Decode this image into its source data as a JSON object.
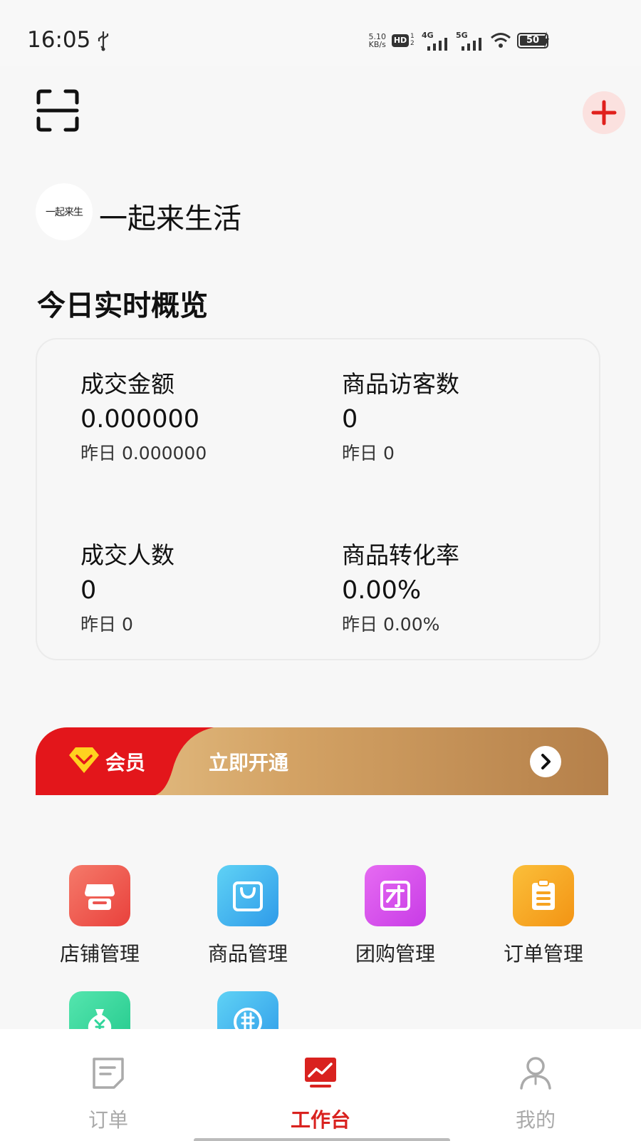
{
  "status_bar": {
    "time": "16:05",
    "net_speed_value": "5.10",
    "net_speed_unit": "KB/s",
    "hd_label": "HD",
    "signal_1": "4G",
    "signal_2": "5G",
    "battery": "50",
    "icons": [
      "usb-icon",
      "hd-icon",
      "signal-icon",
      "wifi-icon",
      "battery-icon",
      "charging-icon"
    ]
  },
  "header": {
    "icons": [
      "scan-icon",
      "add-icon"
    ],
    "accent_color": "#e0201c"
  },
  "shop": {
    "avatar_text": "一起来生",
    "name": "一起来生活"
  },
  "overview": {
    "title": "今日实时概览",
    "stats": [
      {
        "label": "成交金额",
        "value": "0.000000",
        "yesterday": "昨日 0.000000"
      },
      {
        "label": "商品访客数",
        "value": "0",
        "yesterday": "昨日 0"
      },
      {
        "label": "成交人数",
        "value": "0",
        "yesterday": "昨日 0"
      },
      {
        "label": "商品转化率",
        "value": "0.00%",
        "yesterday": "昨日 0.00%"
      }
    ]
  },
  "vip": {
    "label": "会员",
    "cta": "立即开通",
    "colors": {
      "red": "#e3161b",
      "gold_start": "#e9c88f",
      "gold_end": "#b5804a"
    }
  },
  "functions": {
    "items": [
      {
        "label": "店铺管理",
        "icon": "store-icon",
        "color": "#f0524a"
      },
      {
        "label": "商品管理",
        "icon": "shopping-bag-icon",
        "color": "#3fb4f2"
      },
      {
        "label": "团购管理",
        "icon": "group-buy-icon",
        "color": "#d447ea"
      },
      {
        "label": "订单管理",
        "icon": "clipboard-icon",
        "color": "#f6a320"
      },
      {
        "label": "",
        "icon": "money-bag-icon",
        "color": "#2fd59a"
      },
      {
        "label": "",
        "icon": "pin-group-icon",
        "color": "#3fb4f2"
      }
    ]
  },
  "tab_bar": {
    "tabs": [
      {
        "label": "订单",
        "icon": "order-icon",
        "active": false
      },
      {
        "label": "工作台",
        "icon": "dashboard-chart-icon",
        "active": true
      },
      {
        "label": "我的",
        "icon": "profile-icon",
        "active": false
      }
    ],
    "active_color": "#d9221f",
    "inactive_color": "#aaaaaa"
  }
}
